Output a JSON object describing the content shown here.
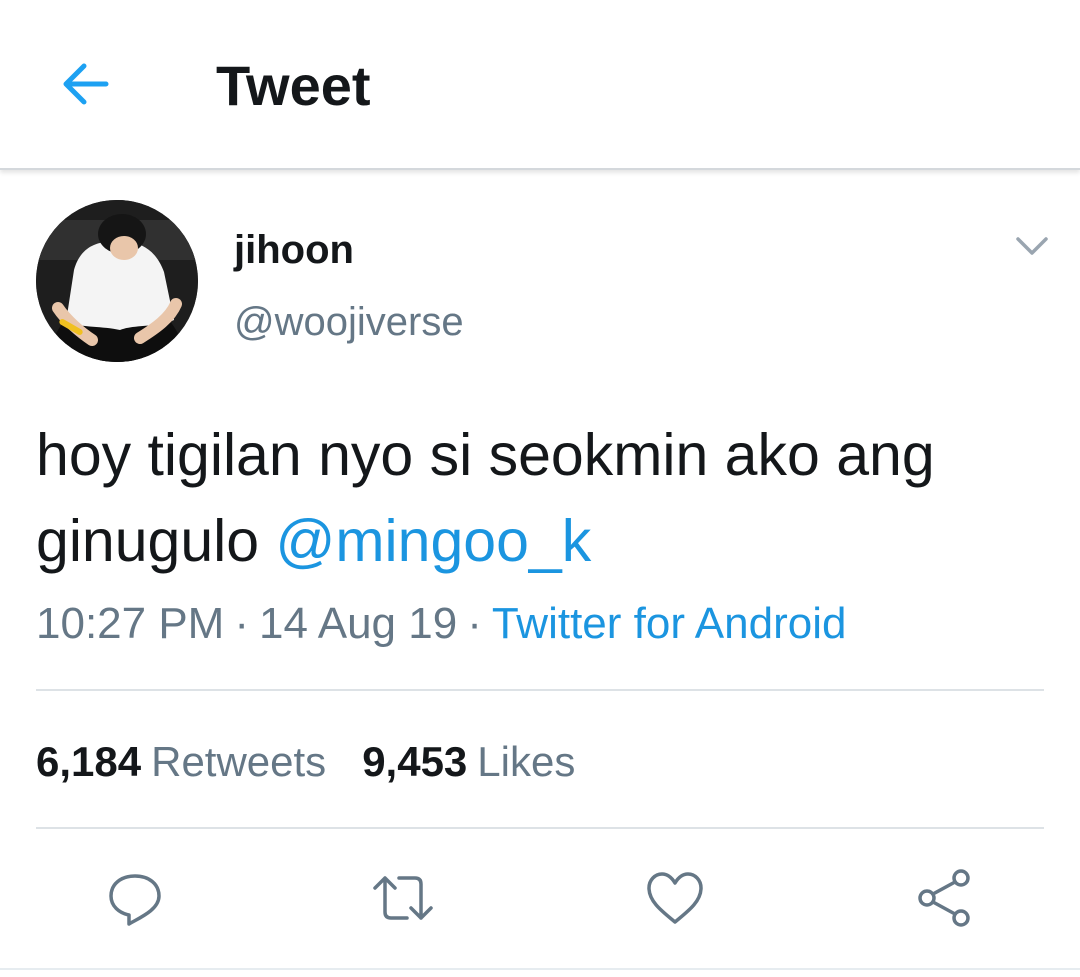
{
  "header": {
    "title": "Tweet",
    "back_icon": "arrow-left-icon",
    "accent": "#1da1f2"
  },
  "author": {
    "display_name": "jihoon",
    "handle": "@woojiverse",
    "avatar_icon": "avatar-photo",
    "menu_icon": "chevron-down-icon"
  },
  "tweet": {
    "text": "hoy tigilan nyo si seokmin ako ang ginugulo ",
    "mention": "@mingoo_k",
    "time": "10:27 PM",
    "separator": "·",
    "date": "14 Aug 19",
    "source": "Twitter for Android"
  },
  "stats": {
    "retweets_count": "6,184",
    "retweets_label": "Retweets",
    "likes_count": "9,453",
    "likes_label": "Likes"
  },
  "actions": [
    {
      "icon": "reply-icon"
    },
    {
      "icon": "retweet-icon"
    },
    {
      "icon": "like-icon"
    },
    {
      "icon": "share-icon"
    }
  ],
  "colors": {
    "text": "#14171a",
    "secondary": "#657786",
    "link": "#1b95e0",
    "divider": "#dde2e6"
  }
}
